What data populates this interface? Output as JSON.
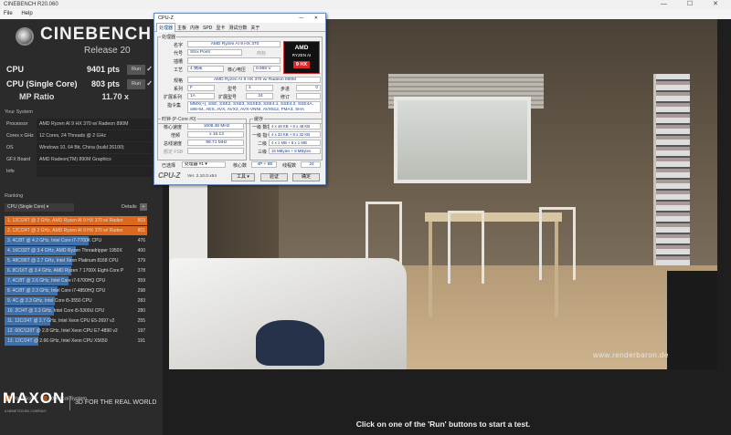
{
  "window": {
    "title": "CINEBENCH R20.060",
    "controls": "— ☐ ✕"
  },
  "menu": {
    "file": "File",
    "help": "Help"
  },
  "brand": {
    "name": "CINEBENCH",
    "release": "Release 20"
  },
  "scores": {
    "cpu": {
      "label": "CPU",
      "value": "9401 pts",
      "run": "Run"
    },
    "single": {
      "label": "CPU (Single Core)",
      "value": "803 pts",
      "run": "Run"
    },
    "mp": {
      "label": "MP Ratio",
      "value": "11.70 x"
    }
  },
  "system": {
    "title": "Your System",
    "rows": [
      {
        "k": "Processor",
        "v": "AMD Ryzen AI 9 HX 370 w/ Radeon 890M"
      },
      {
        "k": "Cores x GHz",
        "v": "12 Cores, 24 Threads @ 2 GHz"
      },
      {
        "k": "OS",
        "v": "Windows 10, 64 Bit, China (build 26100)"
      },
      {
        "k": "GFX Board",
        "v": "AMD Radeon(TM) 890M Graphics"
      },
      {
        "k": "Info",
        "v": ""
      }
    ]
  },
  "ranking": {
    "title": "Ranking",
    "selector": "CPU (Single Core)",
    "details": "Details",
    "max": 803,
    "items": [
      {
        "text": "1. 12C/24T @ 2 GHz, AMD Ryzen AI 9 HX 370 w/ Radeo",
        "score": "803",
        "value": 803,
        "kind": "own"
      },
      {
        "text": "2. 12C/24T @ 2 GHz, AMD Ryzen AI 9 HX 370 w/ Radeo",
        "score": "801",
        "value": 801,
        "kind": "own"
      },
      {
        "text": "3. 4C/8T @ 4.2 GHz, Intel Core i7-7700K CPU",
        "score": "476",
        "value": 476,
        "kind": "ref"
      },
      {
        "text": "4. 16C/32T @ 3.4 GHz, AMD Ryzen Threadripper 1950X",
        "score": "400",
        "value": 400,
        "kind": "ref"
      },
      {
        "text": "5. 48C/96T @ 2.7 GHz, Intel Xeon Platinum 8168 CPU",
        "score": "379",
        "value": 379,
        "kind": "ref"
      },
      {
        "text": "6. 8C/16T @ 3.4 GHz, AMD Ryzen 7 1700X Eight-Core P",
        "score": "378",
        "value": 378,
        "kind": "ref"
      },
      {
        "text": "7. 4C/8T @ 2.6 GHz, Intel Core i7-6700HQ CPU",
        "score": "359",
        "value": 359,
        "kind": "ref"
      },
      {
        "text": "8. 4C/8T @ 2.3 GHz, Intel Core i7-4850HQ CPU",
        "score": "298",
        "value": 298,
        "kind": "ref"
      },
      {
        "text": "9. 4C @ 3.3 GHz, Intel Core i5-3550 CPU",
        "score": "283",
        "value": 283,
        "kind": "ref"
      },
      {
        "text": "10. 2C/4T @ 2.3 GHz, Intel Core i5-5300U CPU",
        "score": "280",
        "value": 280,
        "kind": "ref"
      },
      {
        "text": "11. 12C/24T @ 2.7 GHz, Intel Xeon CPU E5-2697 v2",
        "score": "255",
        "value": 255,
        "kind": "ref"
      },
      {
        "text": "12. 60C/120T @ 2.8 GHz, Intel Xeon CPU E7-4890 v2",
        "score": "197",
        "value": 197,
        "kind": "ref"
      },
      {
        "text": "13. 12C/24T @ 2.66 GHz, Intel Xeon CPU X5650",
        "score": "191",
        "value": 191,
        "kind": "ref"
      }
    ]
  },
  "legend": {
    "your": "Your Score",
    "identical": "Identical System"
  },
  "footer": {
    "maxon": "MAXON",
    "maxon_sub": "A NEMETSCHEK COMPANY",
    "tagline": "3D FOR THE REAL WORLD"
  },
  "render": {
    "watermark": "www.renderbaron.de"
  },
  "status": "Click on one of the 'Run' buttons to start a test.",
  "colors": {
    "own": "#d9691f",
    "ref": "#3f6fa8",
    "identical": "#a8501c"
  },
  "cpuz": {
    "title": "CPU-Z",
    "controls": "— ✕",
    "tabs": [
      "处理器",
      "主板",
      "内存",
      "SPD",
      "显卡",
      "测试分数",
      "关于"
    ],
    "processor_group": "处理器",
    "name_lbl": "名字",
    "name": "AMD Ryzen AI 9 HX 370",
    "code_lbl": "代号",
    "code": "Strix Point",
    "brand_lbl": "商标",
    "socket_lbl": "插槽",
    "tech_lbl": "工艺",
    "tech": "4 纳米",
    "voltage_lbl": "核心电压",
    "voltage": "0.988 V",
    "spec_lbl": "规格",
    "spec": "AMD Ryzen AI 9 HX 370 w/ Radeon 890M",
    "family_lbl": "系列",
    "family": "F",
    "model_lbl": "型号",
    "model": "4",
    "stepping_lbl": "步进",
    "stepping": "0",
    "extfam_lbl": "扩展系列",
    "extfam": "1A",
    "extmod_lbl": "扩展型号",
    "extmod": "24",
    "rev_lbl": "修订",
    "instr_lbl": "指令集",
    "instr": "MMX(+), SSE, SSE2, SSE3, SSSE3, SSE4.1, SSE4.2, SSE4A, x86-64, AES, AVX, AVX2, AVX-VNNI, AVX512, FMA3, SHA",
    "clock_group": "时钟 (P-Core #0)",
    "core_speed_lbl": "核心速度",
    "core_speed": "1608.36 MHz",
    "mult_lbl": "倍频",
    "mult": "x 16.13",
    "bus_lbl": "总线速度",
    "bus": "99.71 MHz",
    "fsb_lbl": "额定 FSB",
    "cache_group": "缓存",
    "l1d_lbl": "一级 数据",
    "l1d": "4 x 48 KB + 8 x 48 KB",
    "l1i_lbl": "一级 指令",
    "l1i": "4 x 32 KB + 8 x 32 KB",
    "l2_lbl": "二级",
    "l2": "4 x 1 MB + 8 x 1 MB",
    "l3_lbl": "三级",
    "l3": "16 MBytes + 8 MBytes",
    "selected_lbl": "已选择",
    "selected": "处理器 #1",
    "cores_lbl": "核心数",
    "cores": "4P + 8E",
    "threads_lbl": "线程数",
    "threads": "24",
    "brand_text": "CPU-Z",
    "version": "Ver. 2.10.0.x64",
    "tools": "工具",
    "validate": "验证",
    "ok": "确定",
    "logo_amd": "AMD",
    "logo_ryzen": "RYZEN AI",
    "logo_tier": "9 HX"
  }
}
